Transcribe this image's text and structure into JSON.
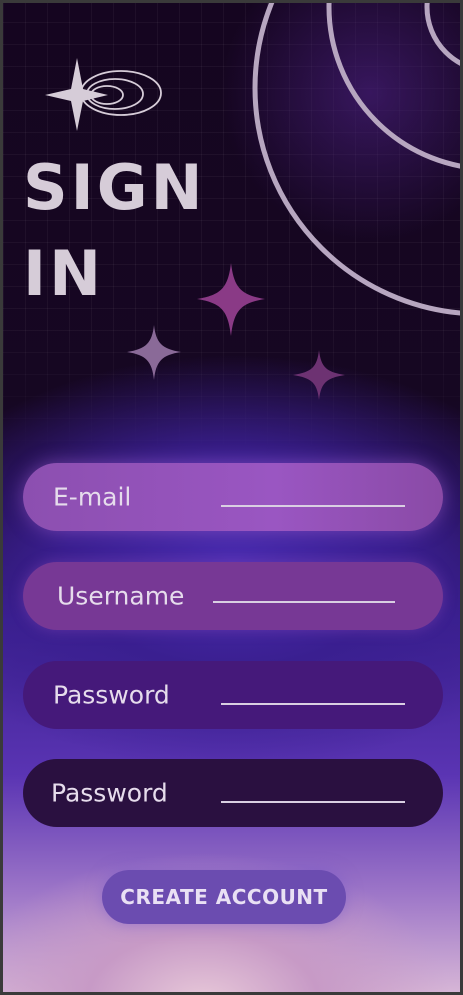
{
  "page": {
    "title": "SIGN\nIN"
  },
  "form": {
    "fields": [
      {
        "label": "E-mail"
      },
      {
        "label": "Username"
      },
      {
        "label": "Password"
      },
      {
        "label": "Password"
      }
    ],
    "submit_label": "CREATE ACCOUNT"
  },
  "colors": {
    "title": "#d6ccd8",
    "sparkle": "#8a3a86",
    "ring": "#b7a6c0",
    "button": "#6b4cb0"
  },
  "icons": [
    "planet-orbit-icon",
    "sparkle-icon"
  ]
}
